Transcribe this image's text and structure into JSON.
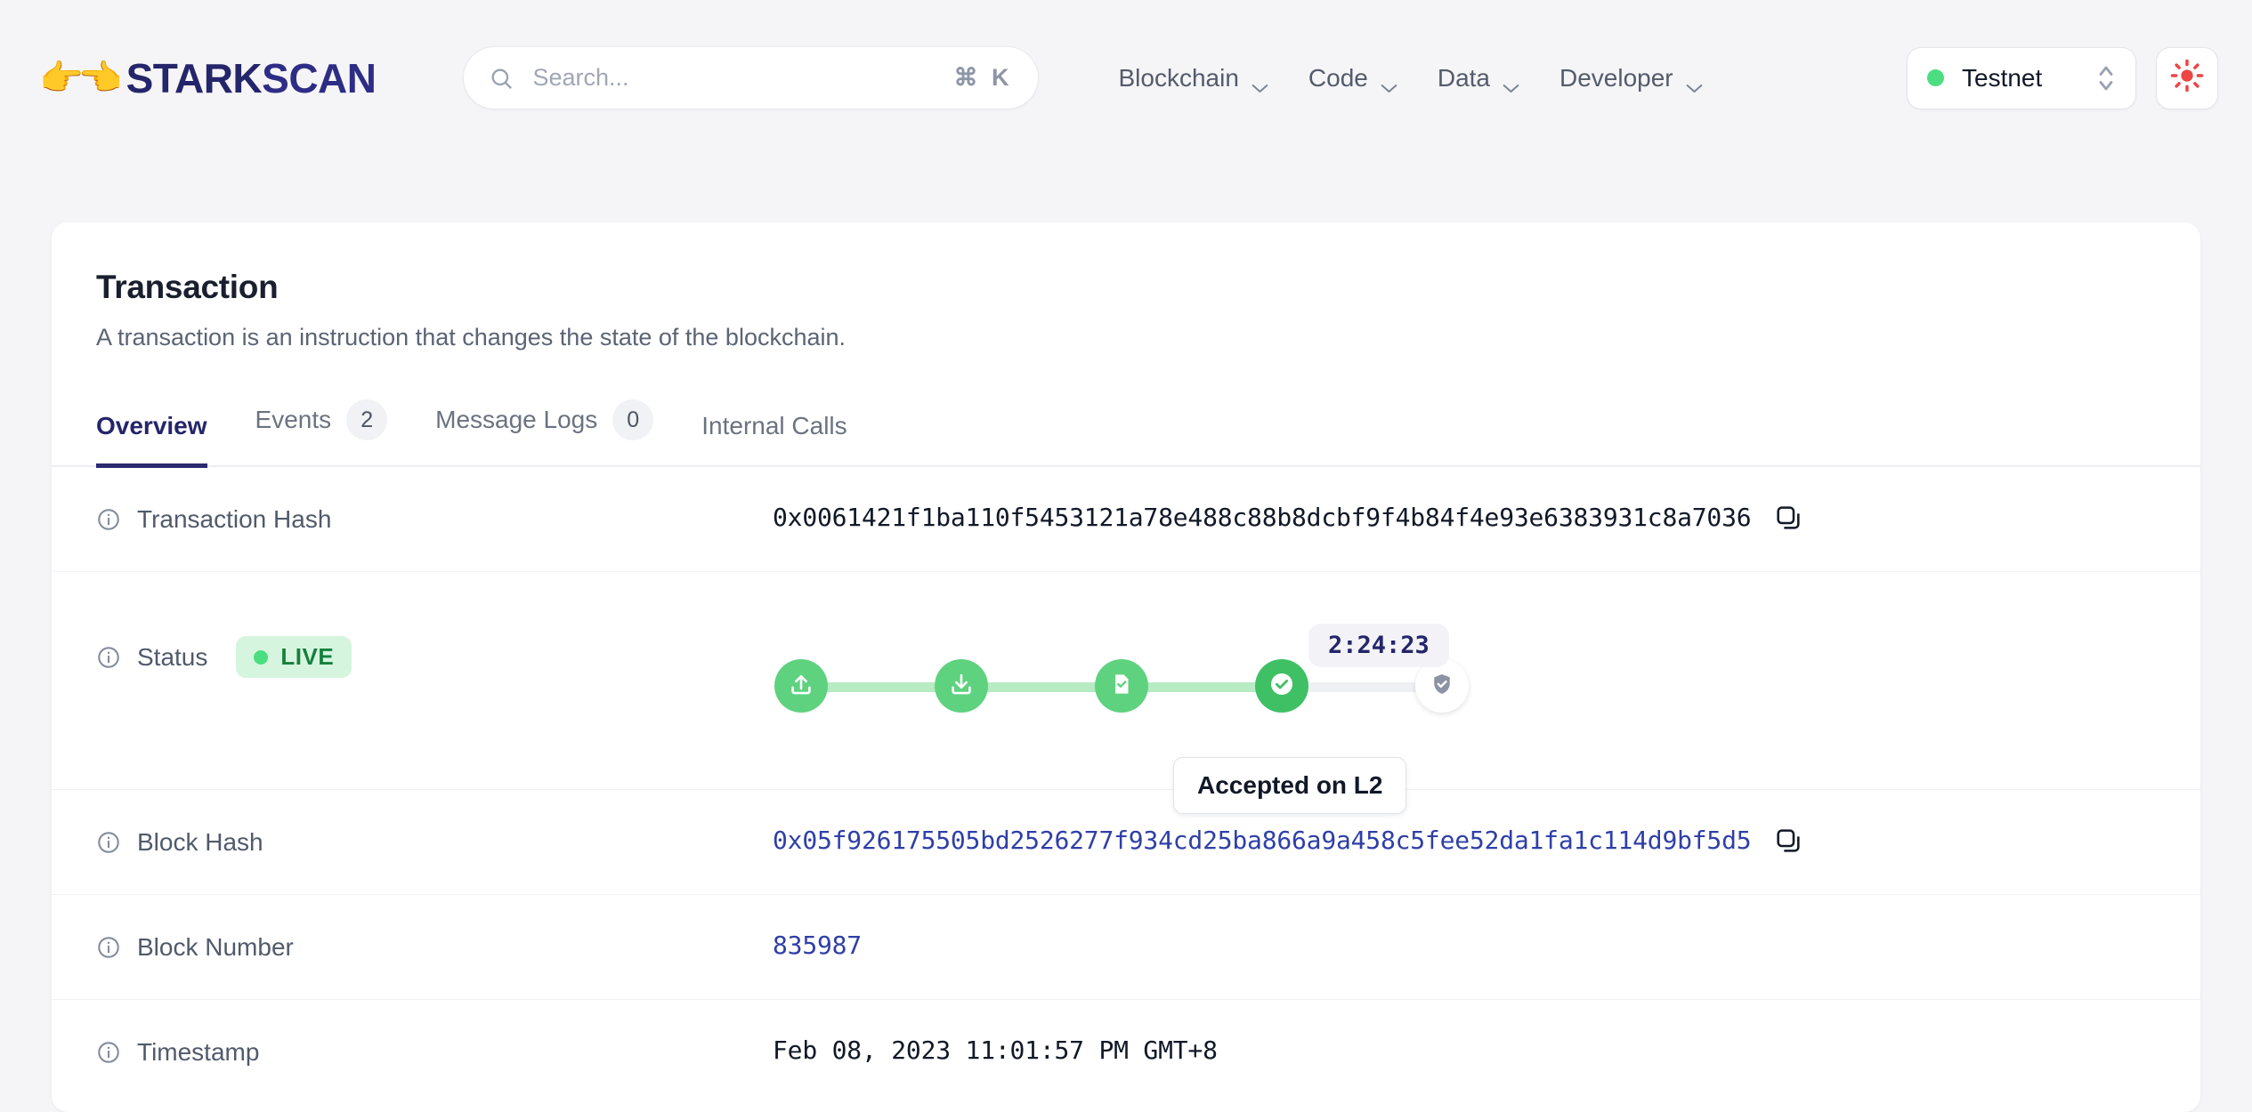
{
  "header": {
    "logo": {
      "emoji_left": "👉",
      "emoji_right": "👈",
      "text_main": "STARK",
      "text_accent": "SCAN"
    },
    "search": {
      "placeholder": "Search...",
      "shortcut": "⌘ K",
      "icon": "search-icon"
    },
    "nav": [
      {
        "label": "Blockchain",
        "icon": "chevron-down-icon"
      },
      {
        "label": "Code",
        "icon": "chevron-down-icon"
      },
      {
        "label": "Data",
        "icon": "chevron-down-icon"
      },
      {
        "label": "Developer",
        "icon": "chevron-down-icon"
      }
    ],
    "network": {
      "label": "Testnet",
      "dot_color": "#4ade80",
      "icon": "chevron-up-down-icon"
    },
    "theme_toggle": {
      "icon": "sun-icon",
      "color": "#ef4444"
    }
  },
  "page": {
    "title": "Transaction",
    "subtitle": "A transaction is an instruction that changes the state of the blockchain."
  },
  "tabs": [
    {
      "label": "Overview",
      "badge": null,
      "active": true
    },
    {
      "label": "Events",
      "badge": "2",
      "active": false
    },
    {
      "label": "Message Logs",
      "badge": "0",
      "active": false
    },
    {
      "label": "Internal Calls",
      "badge": null,
      "active": false
    }
  ],
  "details": {
    "transaction_hash": {
      "label": "Transaction Hash",
      "value": "0x0061421f1ba110f5453121a78e488c88b8dcbf9f4b84f4e93e6383931c8a7036",
      "copy_icon": "copy-icon"
    },
    "status": {
      "label": "Status",
      "badge": "LIVE",
      "timer": "2:24:23",
      "tooltip": "Accepted on L2",
      "steps": [
        {
          "name": "received",
          "icon": "upload-icon",
          "state": "done"
        },
        {
          "name": "pending",
          "icon": "download-icon",
          "state": "done"
        },
        {
          "name": "accepted-on-l2-block",
          "icon": "document-check-icon",
          "state": "done"
        },
        {
          "name": "accepted-on-l2",
          "icon": "check-circle-icon",
          "state": "current"
        },
        {
          "name": "accepted-on-l1",
          "icon": "shield-check-icon",
          "state": "pending"
        }
      ]
    },
    "block_hash": {
      "label": "Block Hash",
      "value": "0x05f926175505bd2526277f934cd25ba866a9a458c5fee52da1fa1c114d9bf5d5",
      "copy_icon": "copy-icon"
    },
    "block_number": {
      "label": "Block Number",
      "value": "835987"
    },
    "timestamp": {
      "label": "Timestamp",
      "value": "Feb 08, 2023  11:01:57 PM GMT+8"
    }
  },
  "colors": {
    "brand": "#25256b",
    "link": "#2f3fa8",
    "green": "#4ade80",
    "green_dark": "#3fc065",
    "track": "#eef0f3"
  }
}
